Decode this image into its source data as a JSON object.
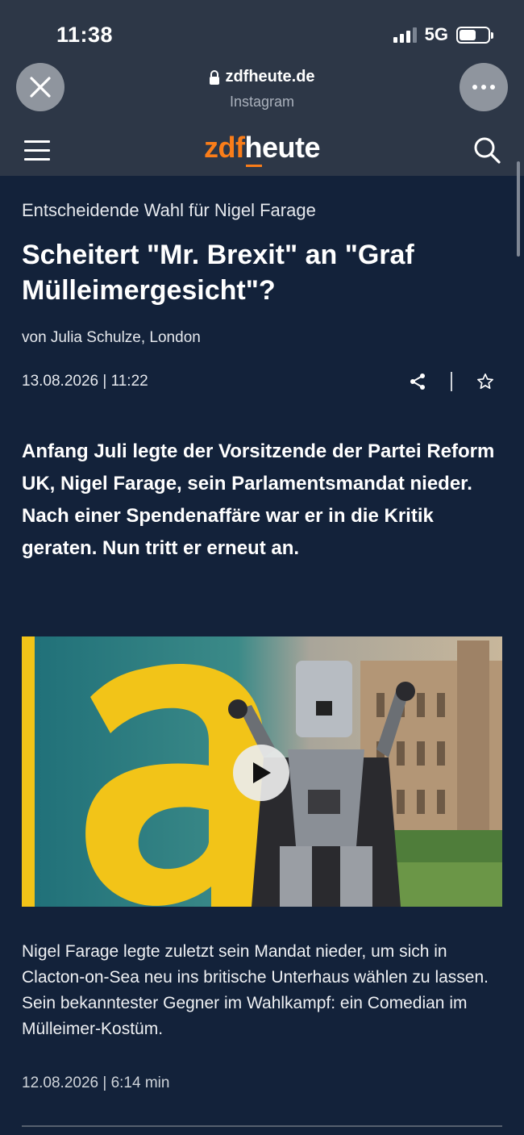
{
  "status_bar": {
    "time": "11:38",
    "network": "5G"
  },
  "browser": {
    "domain": "zdfheute.de",
    "source": "Instagram"
  },
  "site": {
    "logo_part1": "zdf",
    "logo_part2": "heute"
  },
  "article": {
    "kicker": "Entscheidende Wahl für Nigel Farage",
    "headline": "Scheitert \"Mr. Brexit\" an \"Graf Mülleimergesicht\"?",
    "author": "von Julia Schulze, London",
    "date": "13.08.2026 | 11:22",
    "lead": "Anfang Juli legte der Vorsitzende der Partei Reform UK, Nigel Farage, sein Parlamentsmandat nieder. Nach einer Spendenaffäre war er in die Kritik geraten. Nun tritt er erneut an."
  },
  "video": {
    "caption": "Nigel Farage legte zuletzt sein Mandat nieder, um sich in Clacton-on-Sea neu ins britische Unterhaus wählen zu lassen. Sein bekanntester Gegner im Wahlkampf: ein Comedian im Mülleimer-Kostüm.",
    "meta": "12.08.2026 | 6:14 min"
  },
  "icons": {
    "close": "close-icon",
    "more": "more-icon",
    "lock": "lock-icon",
    "menu": "hamburger-icon",
    "search": "search-icon",
    "share": "share-icon",
    "bookmark": "star-icon",
    "play": "play-icon"
  },
  "colors": {
    "background": "#13223a",
    "chrome": "#2d3747",
    "brand_orange": "#fa7d19"
  }
}
